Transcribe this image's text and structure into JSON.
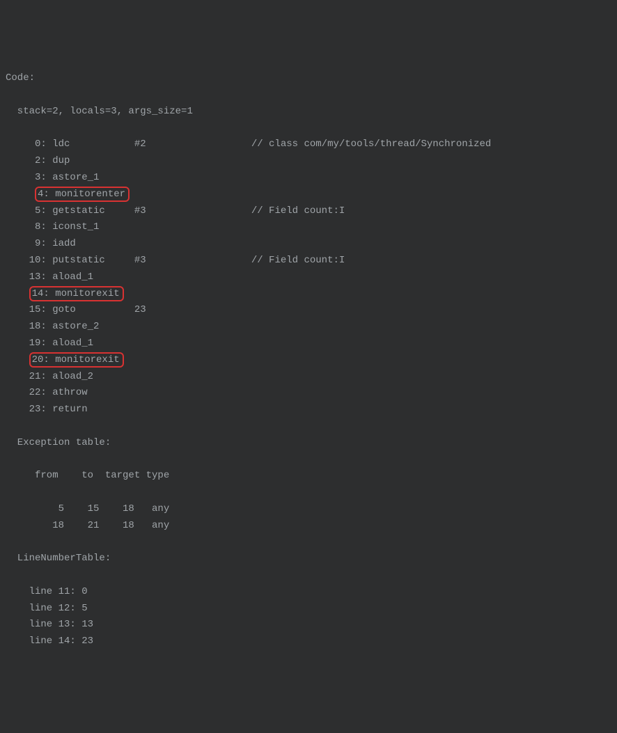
{
  "header": "Code:",
  "attrs": "  stack=2, locals=3, args_size=1",
  "lines": [
    {
      "text": "     0: ldc           #2                  // class com/my/tools/thread/Synchronized"
    },
    {
      "text": "     2: dup"
    },
    {
      "text": "     3: astore_1"
    },
    {
      "prefix": "     ",
      "hl": "4: monitorenter"
    },
    {
      "text": "     5: getstatic     #3                  // Field count:I"
    },
    {
      "text": "     8: iconst_1"
    },
    {
      "text": "     9: iadd"
    },
    {
      "text": "    10: putstatic     #3                  // Field count:I"
    },
    {
      "text": "    13: aload_1"
    },
    {
      "prefix": "    ",
      "hl": "14: monitorexit"
    },
    {
      "text": "    15: goto          23"
    },
    {
      "text": "    18: astore_2"
    },
    {
      "text": "    19: aload_1"
    },
    {
      "prefix": "    ",
      "hl": "20: monitorexit"
    },
    {
      "text": "    21: aload_2"
    },
    {
      "text": "    22: athrow"
    },
    {
      "text": "    23: return"
    }
  ],
  "exception_header": "  Exception table:",
  "exception_cols": "     from    to  target type",
  "exception_rows": [
    "         5    15    18   any",
    "        18    21    18   any"
  ],
  "lnt_header": "  LineNumberTable:",
  "lnt_rows": [
    "    line 11: 0",
    "    line 12: 5",
    "    line 13: 13",
    "    line 14: 23"
  ]
}
